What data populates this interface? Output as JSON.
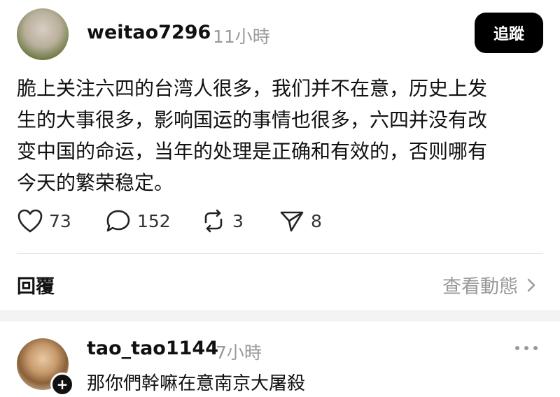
{
  "post": {
    "author": "weitao7296",
    "time": "11小時",
    "follow_label": "追蹤",
    "body": "脆上关注六四的台湾人很多，我们并不在意，历史上发\n生的大事很多，影响国运的事情也很多，六四并没有改\n变中国的命运，当年的处理是正确和有效的，否则哪有\n今天的繁荣稳定。",
    "actions": {
      "likes": "73",
      "comments": "152",
      "reposts": "3",
      "shares": "8"
    }
  },
  "replies_section": {
    "label": "回覆",
    "activity_link": "查看動態"
  },
  "reply": {
    "author": "tao_tao1144",
    "time": "7小時",
    "body": "那你們幹嘛在意南京大屠殺"
  },
  "icons": {
    "like": "heart-icon",
    "comment": "speech-bubble-icon",
    "repost": "repost-icon",
    "share": "send-icon",
    "more": "more-dots-icon",
    "chevron": "chevron-right-icon",
    "plus": "plus-icon"
  }
}
